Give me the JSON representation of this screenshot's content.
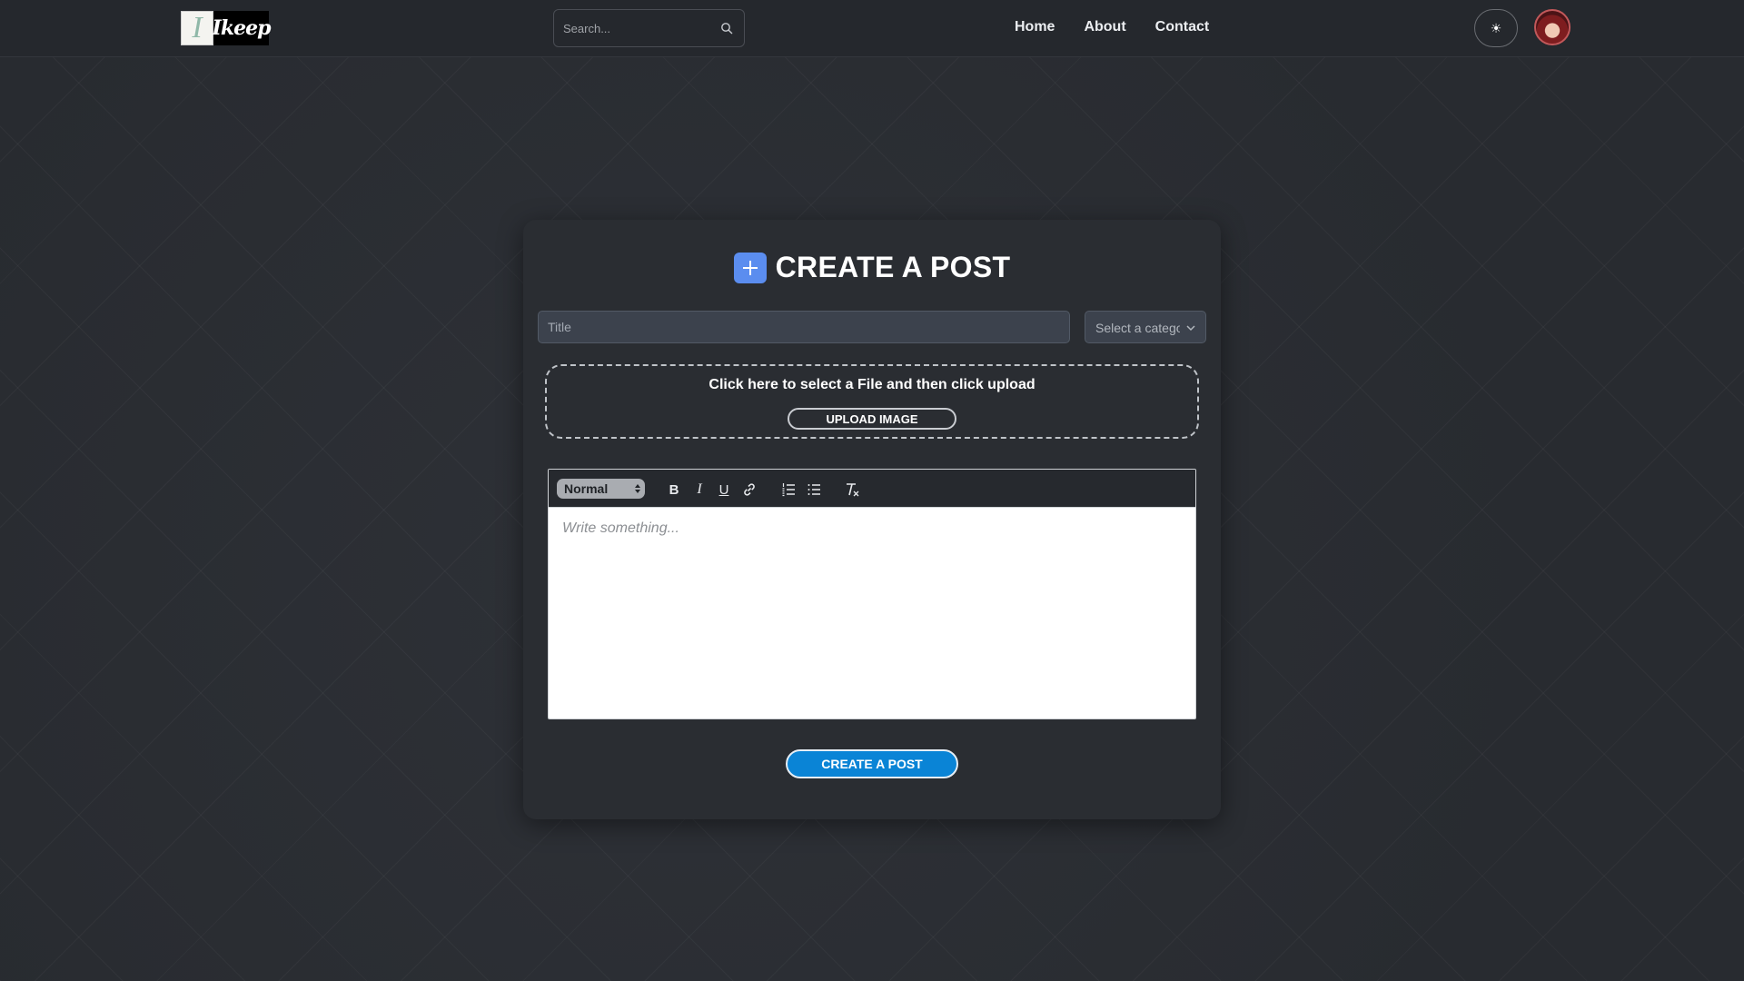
{
  "navbar": {
    "logo": {
      "left_glyph": "I",
      "right_text": "Ikeep"
    },
    "search": {
      "placeholder": "Search..."
    },
    "links": [
      {
        "label": "Home"
      },
      {
        "label": "About"
      },
      {
        "label": "Contact"
      }
    ],
    "theme_toggle_icon": "sun-icon",
    "theme_toggle_glyph": "☀",
    "avatar_icon": "user-avatar"
  },
  "form": {
    "title": "CREATE A POST",
    "title_input": {
      "placeholder": "Title",
      "value": ""
    },
    "category_select": {
      "placeholder": "Select a category"
    },
    "upload": {
      "instruction": "Click here to select a File and then click upload",
      "button_label": "UPLOAD IMAGE"
    },
    "editor": {
      "format": "Normal",
      "toolbar": [
        "bold",
        "italic",
        "underline",
        "link",
        "ordered-list",
        "bullet-list",
        "clean-format"
      ],
      "bold_label": "B",
      "italic_label": "I",
      "underline_label": "U",
      "placeholder": "Write something..."
    },
    "submit_label": "CREATE A POST"
  },
  "colors": {
    "accent": "#5b8def",
    "submit": "#0a84d6",
    "background": "#2b2e34"
  }
}
